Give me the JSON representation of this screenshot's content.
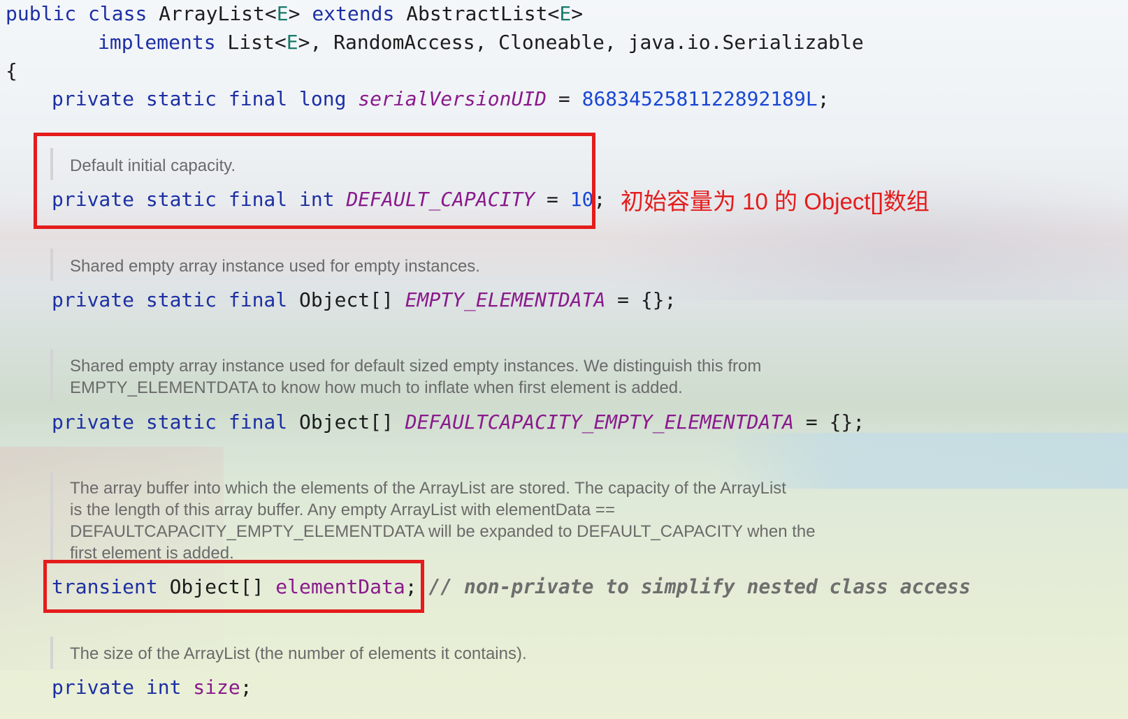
{
  "class_decl": {
    "public": "public",
    "class": "class",
    "name": "ArrayList<",
    "gen1": "E",
    "close1": "> ",
    "extends": "extends",
    "super": " AbstractList<",
    "gen2": "E",
    "close2": ">"
  },
  "implements_line": {
    "implements": "implements",
    "list": " List<",
    "gen": "E",
    "rest": ">, RandomAccess, Cloneable, java.io.Serializable"
  },
  "open_brace": "{",
  "serial": {
    "mods": "private static final long ",
    "name": "serialVersionUID",
    "eq": " = ",
    "value": "8683452581122892189L",
    "semi": ";"
  },
  "default_capacity": {
    "doc": "Default initial capacity.",
    "mods": "private static final int ",
    "name": "DEFAULT_CAPACITY",
    "eq": " = ",
    "value": "10",
    "semi": ";"
  },
  "annotation": "初始容量为 10 的 Object[]数组",
  "empty_elementdata": {
    "doc": "Shared empty array instance used for empty instances.",
    "mods": "private static final ",
    "type": "Object[] ",
    "name": "EMPTY_ELEMENTDATA",
    "rest": " = {};"
  },
  "defaultcapacity_empty": {
    "doc_lines": [
      "Shared empty array instance used for default sized empty instances. We distinguish this from",
      "EMPTY_ELEMENTDATA to know how much to inflate when first element is added."
    ],
    "mods": "private static final ",
    "type": "Object[] ",
    "name": "DEFAULTCAPACITY_EMPTY_ELEMENTDATA",
    "rest": " = {};"
  },
  "element_data": {
    "doc_lines": [
      "The array buffer into which the elements of the ArrayList are stored. The capacity of the ArrayList",
      "is the length of this array buffer. Any empty ArrayList with elementData ==",
      "DEFAULTCAPACITY_EMPTY_ELEMENTDATA will be expanded to DEFAULT_CAPACITY when the",
      "first element is added."
    ],
    "mod": "transient",
    "type": " Object[] ",
    "name": "elementData",
    "semi": "; ",
    "comment": "// non-private to simplify nested class access"
  },
  "size_field": {
    "doc": "The size of the ArrayList (the number of elements it contains).",
    "mods": "private int ",
    "name": "size",
    "semi": ";"
  }
}
